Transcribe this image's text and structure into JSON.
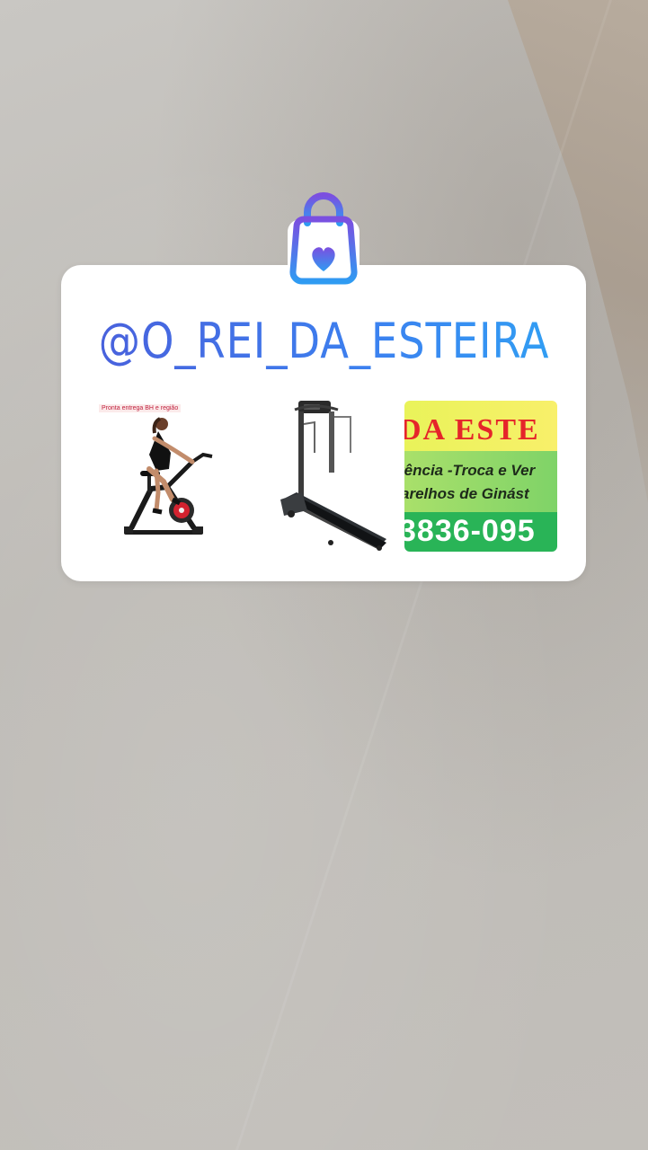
{
  "sticker": {
    "mention": "@O_REI_DA_ESTEIRA",
    "icon": "shopping-bag-heart-icon",
    "accent_gradient": [
      "#4b5bd9",
      "#2ea6f4"
    ]
  },
  "products": [
    {
      "name": "exercise-bike",
      "tag": "Pronta entrega BH e região"
    },
    {
      "name": "treadmill"
    },
    {
      "name": "store-ad",
      "title": "DA ESTE",
      "line1": "tência -Troca e Ver",
      "line2": "arelhos de Ginást",
      "phone": "3836-095"
    }
  ]
}
